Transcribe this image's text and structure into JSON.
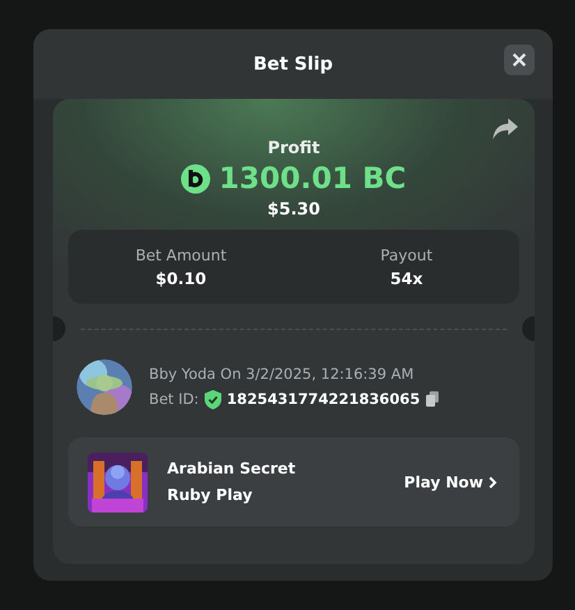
{
  "dialog": {
    "title": "Bet Slip"
  },
  "profit": {
    "label": "Profit",
    "amount": "1300.01 BC",
    "usd": "$5.30"
  },
  "stats": [
    {
      "label": "Bet Amount",
      "value": "$0.10"
    },
    {
      "label": "Payout",
      "value": "54x"
    }
  ],
  "bet": {
    "user_line": "Bby Yoda On 3/2/2025, 12:16:39 AM",
    "id_label": "Bet ID:",
    "id": "1825431774221836065"
  },
  "game": {
    "name": "Arabian Secret",
    "provider": "Ruby Play",
    "action": "Play Now"
  }
}
